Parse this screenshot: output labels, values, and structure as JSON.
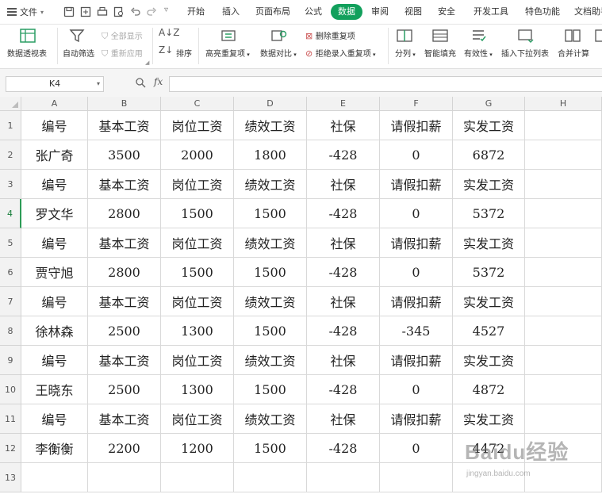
{
  "menubar": {
    "file_label": "文件",
    "tabs": [
      "开始",
      "插入",
      "页面布局",
      "公式",
      "数据",
      "审阅",
      "视图",
      "安全",
      "开发工具",
      "特色功能",
      "文档助手"
    ],
    "active_tab": "数据"
  },
  "ribbon": {
    "pivot": "数据透视表",
    "autofilter": "自动筛选",
    "show_all": "全部显示",
    "reapply": "重新应用",
    "sort": "排序",
    "highlight_dup": "高亮重复项",
    "compare": "数据对比",
    "delete_dup": "删除重复项",
    "reject_dup": "拒绝录入重复项",
    "split": "分列",
    "smart_fill": "智能填充",
    "validity": "有效性",
    "dropdown_list": "插入下拉列表",
    "merge_calc": "合并计算"
  },
  "formula_bar": {
    "name_box": "K4",
    "fx_label": "fx",
    "formula": ""
  },
  "sheet": {
    "columns": [
      "A",
      "B",
      "C",
      "D",
      "E",
      "F",
      "G",
      "H"
    ],
    "row_numbers": [
      "1",
      "2",
      "3",
      "4",
      "5",
      "6",
      "7",
      "8",
      "9",
      "10",
      "11",
      "12",
      "13"
    ],
    "rows": [
      [
        "编号",
        "基本工资",
        "岗位工资",
        "绩效工资",
        "社保",
        "请假扣薪",
        "实发工资",
        ""
      ],
      [
        "张广奇",
        "3500",
        "2000",
        "1800",
        "-428",
        "0",
        "6872",
        ""
      ],
      [
        "编号",
        "基本工资",
        "岗位工资",
        "绩效工资",
        "社保",
        "请假扣薪",
        "实发工资",
        ""
      ],
      [
        "罗文华",
        "2800",
        "1500",
        "1500",
        "-428",
        "0",
        "5372",
        ""
      ],
      [
        "编号",
        "基本工资",
        "岗位工资",
        "绩效工资",
        "社保",
        "请假扣薪",
        "实发工资",
        ""
      ],
      [
        "贾守旭",
        "2800",
        "1500",
        "1500",
        "-428",
        "0",
        "5372",
        ""
      ],
      [
        "编号",
        "基本工资",
        "岗位工资",
        "绩效工资",
        "社保",
        "请假扣薪",
        "实发工资",
        ""
      ],
      [
        "徐林森",
        "2500",
        "1300",
        "1500",
        "-428",
        "-345",
        "4527",
        ""
      ],
      [
        "编号",
        "基本工资",
        "岗位工资",
        "绩效工资",
        "社保",
        "请假扣薪",
        "实发工资",
        ""
      ],
      [
        "王晓东",
        "2500",
        "1300",
        "1500",
        "-428",
        "0",
        "4872",
        ""
      ],
      [
        "编号",
        "基本工资",
        "岗位工资",
        "绩效工资",
        "社保",
        "请假扣薪",
        "实发工资",
        ""
      ],
      [
        "李衡衡",
        "2200",
        "1200",
        "1500",
        "-428",
        "0",
        "4472",
        ""
      ],
      [
        "",
        "",
        "",
        "",
        "",
        "",
        "",
        ""
      ]
    ],
    "selected_row": "4"
  },
  "watermark": {
    "brand": "Baidu经验",
    "url": "jingyan.baidu.com"
  },
  "colors": {
    "accent": "#12a05c",
    "selected_row_header": "#2d9b56"
  }
}
